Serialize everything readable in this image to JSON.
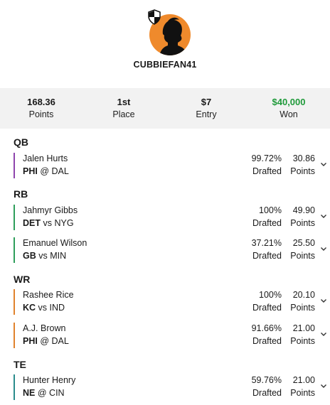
{
  "user": {
    "username": "CUBBIEFAN41",
    "avatar_color": "#ef8a2c",
    "badge_icon": "shield-icon"
  },
  "stats": [
    {
      "value": "168.36",
      "label": "Points"
    },
    {
      "value": "1st",
      "label": "Place"
    },
    {
      "value": "$7",
      "label": "Entry"
    },
    {
      "value": "$40,000",
      "label": "Won",
      "color": "#1f9a3a"
    }
  ],
  "sections": [
    {
      "label": "QB",
      "players": [
        {
          "name": "Jalen Hurts",
          "team": "PHI",
          "matchup_sep": "@",
          "opponent": "DAL",
          "drafted_value": "99.72%",
          "drafted_label": "Drafted",
          "points_value": "30.86",
          "points_label": "Points",
          "color": "#8e44ad"
        }
      ]
    },
    {
      "label": "RB",
      "players": [
        {
          "name": "Jahmyr Gibbs",
          "team": "DET",
          "matchup_sep": "vs",
          "opponent": "NYG",
          "drafted_value": "100%",
          "drafted_label": "Drafted",
          "points_value": "49.90",
          "points_label": "Points",
          "color": "#2e9e5b"
        },
        {
          "name": "Emanuel Wilson",
          "team": "GB",
          "matchup_sep": "vs",
          "opponent": "MIN",
          "drafted_value": "37.21%",
          "drafted_label": "Drafted",
          "points_value": "25.50",
          "points_label": "Points",
          "color": "#2e9e5b"
        }
      ]
    },
    {
      "label": "WR",
      "players": [
        {
          "name": "Rashee Rice",
          "team": "KC",
          "matchup_sep": "vs",
          "opponent": "IND",
          "drafted_value": "100%",
          "drafted_label": "Drafted",
          "points_value": "20.10",
          "points_label": "Points",
          "color": "#e0822d"
        },
        {
          "name": "A.J. Brown",
          "team": "PHI",
          "matchup_sep": "@",
          "opponent": "DAL",
          "drafted_value": "91.66%",
          "drafted_label": "Drafted",
          "points_value": "21.00",
          "points_label": "Points",
          "color": "#e0822d"
        }
      ]
    },
    {
      "label": "TE",
      "players": [
        {
          "name": "Hunter Henry",
          "team": "NE",
          "matchup_sep": "@",
          "opponent": "CIN",
          "drafted_value": "59.76%",
          "drafted_label": "Drafted",
          "points_value": "21.00",
          "points_label": "Points",
          "color": "#2a8c8c"
        }
      ]
    }
  ]
}
